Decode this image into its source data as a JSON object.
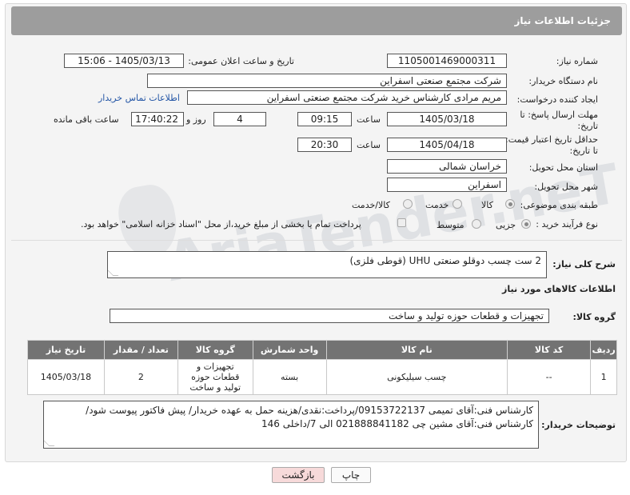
{
  "header": {
    "title": "جزئیات اطلاعات نیاز"
  },
  "form": {
    "need_number_label": "شماره نیاز:",
    "need_number": "1105001469000311",
    "announce_label": "تاریخ و ساعت اعلان عمومی:",
    "announce_value": "1405/03/13 - 15:06",
    "buyer_org_label": "نام دستگاه خریدار:",
    "buyer_org": "شرکت مجتمع صنعتی اسفراین",
    "requester_label": "ایجاد کننده درخواست:",
    "requester": "مریم مرادی کارشناس خرید شرکت مجتمع صنعتی اسفراین",
    "contact_link": "اطلاعات تماس خریدار",
    "deadline_label_line1": "مهلت ارسال پاسخ: تا",
    "deadline_label_line2": "تاریخ:",
    "deadline_date": "1405/03/18",
    "hour_label": "ساعت",
    "deadline_time": "09:15",
    "days_value": "4",
    "days_label": "روز و",
    "remaining_time": "17:40:22",
    "remaining_label": "ساعت باقی مانده",
    "price_label_line1": "حداقل تاریخ اعتبار قیمت:",
    "price_label_line2": "تا تاریخ:",
    "price_date": "1405/04/18",
    "price_hour_label": "ساعت",
    "price_time": "20:30",
    "province_label": "استان محل تحویل:",
    "province": "خراسان شمالی",
    "city_label": "شهر محل تحویل:",
    "city": "اسفراین",
    "category_label": "طبقه بندی موضوعی:",
    "category_options": [
      "کالا",
      "خدمت",
      "کالا/خدمت"
    ],
    "process_label": "نوع فرآیند خرید :",
    "process_options": [
      "جزیی",
      "متوسط"
    ],
    "payment_note": "پرداخت تمام یا بخشی از مبلغ خرید،از محل \"اسناد خزانه اسلامی\" خواهد بود."
  },
  "description": {
    "label": "شرح کلی نیاز:",
    "text": "2 ست چسب دوقلو صنعتی UHU (قوطی فلزی)"
  },
  "goods_section": {
    "title": "اطلاعات کالاهای مورد نیاز",
    "group_label": "گروه کالا:",
    "group_value": "تجهیزات و قطعات حوزه تولید و ساخت"
  },
  "table": {
    "headers": [
      "ردیف",
      "کد کالا",
      "نام کالا",
      "واحد شمارش",
      "گروه کالا",
      "تعداد / مقدار",
      "تاریخ نیاز"
    ],
    "rows": [
      {
        "row": "1",
        "code": "--",
        "name": "چسب سیلیکونی",
        "unit": "بسته",
        "group": "تجهیزات و قطعات حوزه تولید و ساخت",
        "qty": "2",
        "date": "1405/03/18"
      }
    ]
  },
  "buyer_notes": {
    "label": "توضیحات خریدار:",
    "text": "کارشناس فنی:آقای تمیمی 09153722137/پرداخت:نقدی/هزینه حمل به عهده خریدار/ پیش فاکتور پیوست شود/کارشناس فنی:آقای مشین چی 021888841182 الی 7/داخلی 146"
  },
  "buttons": {
    "print": "چاپ",
    "back": "بازگشت"
  },
  "watermark": "AriaTender.neT",
  "colors": {
    "header_bg": "#9d9d9d",
    "table_header_bg": "#737373",
    "link": "#2456a6",
    "back_button_bg": "#f7dada"
  }
}
